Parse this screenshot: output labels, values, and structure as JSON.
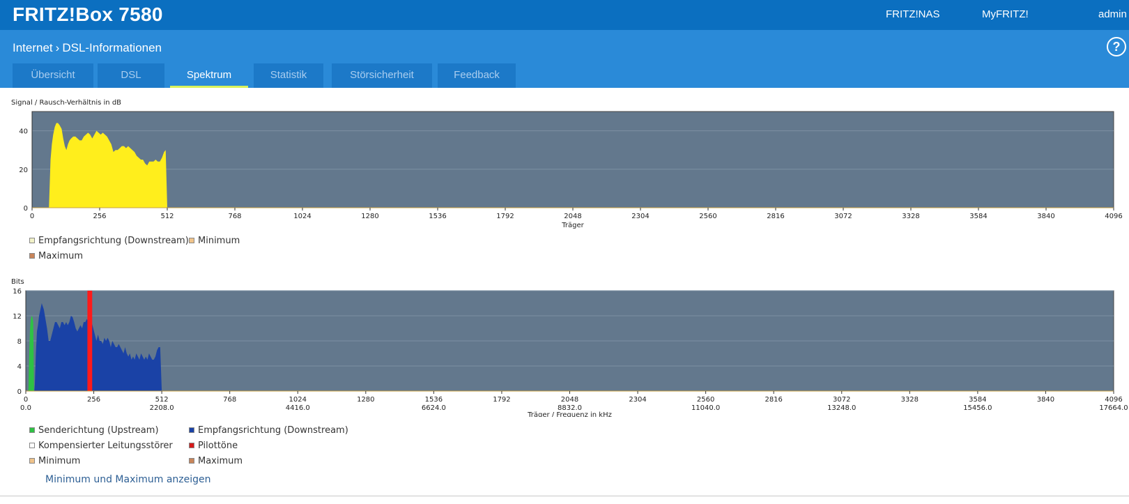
{
  "header": {
    "brand": "FRITZ!Box 7580",
    "links": [
      "FRITZ!NAS",
      "MyFRITZ!",
      "admin"
    ]
  },
  "breadcrumb": {
    "parent": "Internet",
    "current": "DSL-Informationen",
    "help": "?"
  },
  "tabs": [
    {
      "label": "Übersicht",
      "active": false
    },
    {
      "label": "DSL",
      "active": false
    },
    {
      "label": "Spektrum",
      "active": true
    },
    {
      "label": "Statistik",
      "active": false
    },
    {
      "label": "Störsicherheit",
      "active": false
    },
    {
      "label": "Feedback",
      "active": false
    }
  ],
  "chart_data": [
    {
      "type": "area",
      "ylabel": "Signal / Rausch-Verhältnis in dB",
      "xlabel": "Träger",
      "xlim": [
        0,
        4096
      ],
      "ylim": [
        0,
        50
      ],
      "yticks": [
        0,
        20,
        40
      ],
      "xticks": [
        0,
        256,
        512,
        768,
        1024,
        1280,
        1536,
        1792,
        2048,
        2304,
        2560,
        2816,
        3072,
        3328,
        3584,
        3840,
        4096
      ],
      "grid": true,
      "colors": {
        "plot_bg": "#63788d",
        "downstream": "#ffee1c"
      },
      "series": [
        {
          "name": "Empfangsrichtung (Downstream)",
          "color": "#ffee1c",
          "x": [
            64,
            70,
            75,
            80,
            86,
            92,
            98,
            104,
            112,
            118,
            124,
            130,
            136,
            142,
            148,
            156,
            164,
            172,
            180,
            188,
            196,
            204,
            212,
            220,
            228,
            236,
            244,
            252,
            260,
            268,
            276,
            284,
            292,
            300,
            308,
            316,
            324,
            332,
            340,
            348,
            356,
            364,
            372,
            380,
            388,
            396,
            404,
            412,
            420,
            428,
            436,
            444,
            452,
            460,
            468,
            476,
            484,
            492,
            500,
            506,
            512
          ],
          "y": [
            0,
            25,
            33,
            38,
            42,
            44,
            44,
            43,
            41,
            36,
            32,
            30,
            33,
            35,
            36,
            37,
            37,
            36,
            35,
            35,
            37,
            38,
            39,
            38,
            36,
            38,
            40,
            39,
            38,
            39,
            38,
            37,
            35,
            33,
            29,
            30,
            30,
            31,
            32,
            32,
            31,
            32,
            31,
            30,
            29,
            27,
            26,
            25,
            25,
            23,
            22,
            24,
            24,
            24,
            25,
            24,
            24,
            26,
            29,
            30,
            0
          ]
        }
      ],
      "legend": [
        {
          "label": "Empfangsrichtung (Downstream)",
          "color": "#f2f2c8"
        },
        {
          "label": "Minimum",
          "color": "#f0c38a"
        },
        {
          "label": "Maximum",
          "color": "#c9855a"
        }
      ]
    },
    {
      "type": "area",
      "ylabel": "Bits",
      "xlabel": "Träger / Frequenz in kHz",
      "xlim": [
        0,
        4096
      ],
      "ylim": [
        0,
        16
      ],
      "yticks": [
        0,
        4,
        8,
        12,
        16
      ],
      "xticks": [
        0,
        256,
        512,
        768,
        1024,
        1280,
        1536,
        1792,
        2048,
        2304,
        2560,
        2816,
        3072,
        3328,
        3584,
        3840,
        4096
      ],
      "freq_labels": [
        "0.0",
        "2208.0",
        "4416.0",
        "6624.0",
        "8832.0",
        "11040.0",
        "13248.0",
        "15456.0",
        "17664.0"
      ],
      "grid": true,
      "colors": {
        "plot_bg": "#63788d"
      },
      "series": [
        {
          "name": "Senderichtung (Upstream)",
          "color": "#2ec244",
          "x": [
            10,
            13,
            16,
            19,
            22,
            25,
            28,
            31
          ],
          "y": [
            0,
            6,
            10,
            11.5,
            12,
            11.8,
            11,
            0
          ]
        },
        {
          "name": "Empfangsrichtung (Downstream)",
          "color": "#1a42a6",
          "x": [
            32,
            34,
            38,
            42,
            46,
            50,
            55,
            60,
            64,
            68,
            72,
            76,
            80,
            86,
            92,
            98,
            104,
            110,
            116,
            122,
            128,
            134,
            140,
            146,
            152,
            158,
            164,
            170,
            176,
            182,
            188,
            194,
            200,
            206,
            212,
            218,
            224,
            230,
            236,
            242,
            248,
            254,
            260,
            266,
            272,
            278,
            284,
            290,
            296,
            302,
            308,
            314,
            320,
            326,
            332,
            338,
            344,
            350,
            356,
            362,
            368,
            374,
            380,
            386,
            392,
            398,
            404,
            410,
            416,
            422,
            428,
            434,
            440,
            446,
            452,
            458,
            464,
            470,
            476,
            482,
            488,
            494,
            500,
            506,
            512
          ],
          "y": [
            0,
            1,
            6,
            9.5,
            10.5,
            12,
            13,
            14,
            13.5,
            13,
            12,
            11,
            10,
            8,
            8,
            9,
            10,
            11,
            11,
            10.5,
            10,
            11,
            11,
            10.5,
            11,
            10.5,
            11,
            12,
            11.8,
            11,
            10,
            9.5,
            10,
            10.5,
            10,
            11,
            11,
            11.5,
            11,
            10,
            11,
            10,
            9,
            8,
            9,
            8,
            8,
            7.5,
            8.5,
            8,
            8.5,
            8,
            7,
            8,
            7.5,
            7,
            7,
            7.5,
            7,
            6.5,
            6,
            7,
            6,
            5.5,
            6,
            5,
            5.5,
            5,
            6,
            5.5,
            5,
            6,
            5.5,
            5,
            5.5,
            5,
            6,
            5.5,
            5,
            5,
            5.5,
            6.5,
            7,
            7,
            0
          ]
        },
        {
          "name": "Pilottöne",
          "color": "#ff1a1a",
          "x": [
            232,
            250
          ],
          "y": [
            16,
            16
          ]
        }
      ],
      "legend": [
        {
          "label": "Senderichtung (Upstream)",
          "color": "#2ec244"
        },
        {
          "label": "Empfangsrichtung (Downstream)",
          "color": "#1a42a6"
        },
        {
          "label": "Kompensierter Leitungsstörer",
          "color": "#ffffff"
        },
        {
          "label": "Pilottöne",
          "color": "#d61a1a"
        },
        {
          "label": "Minimum",
          "color": "#f0c38a"
        },
        {
          "label": "Maximum",
          "color": "#c9855a"
        }
      ]
    }
  ],
  "show_minmax_link": "Minimum und Maximum anzeigen"
}
